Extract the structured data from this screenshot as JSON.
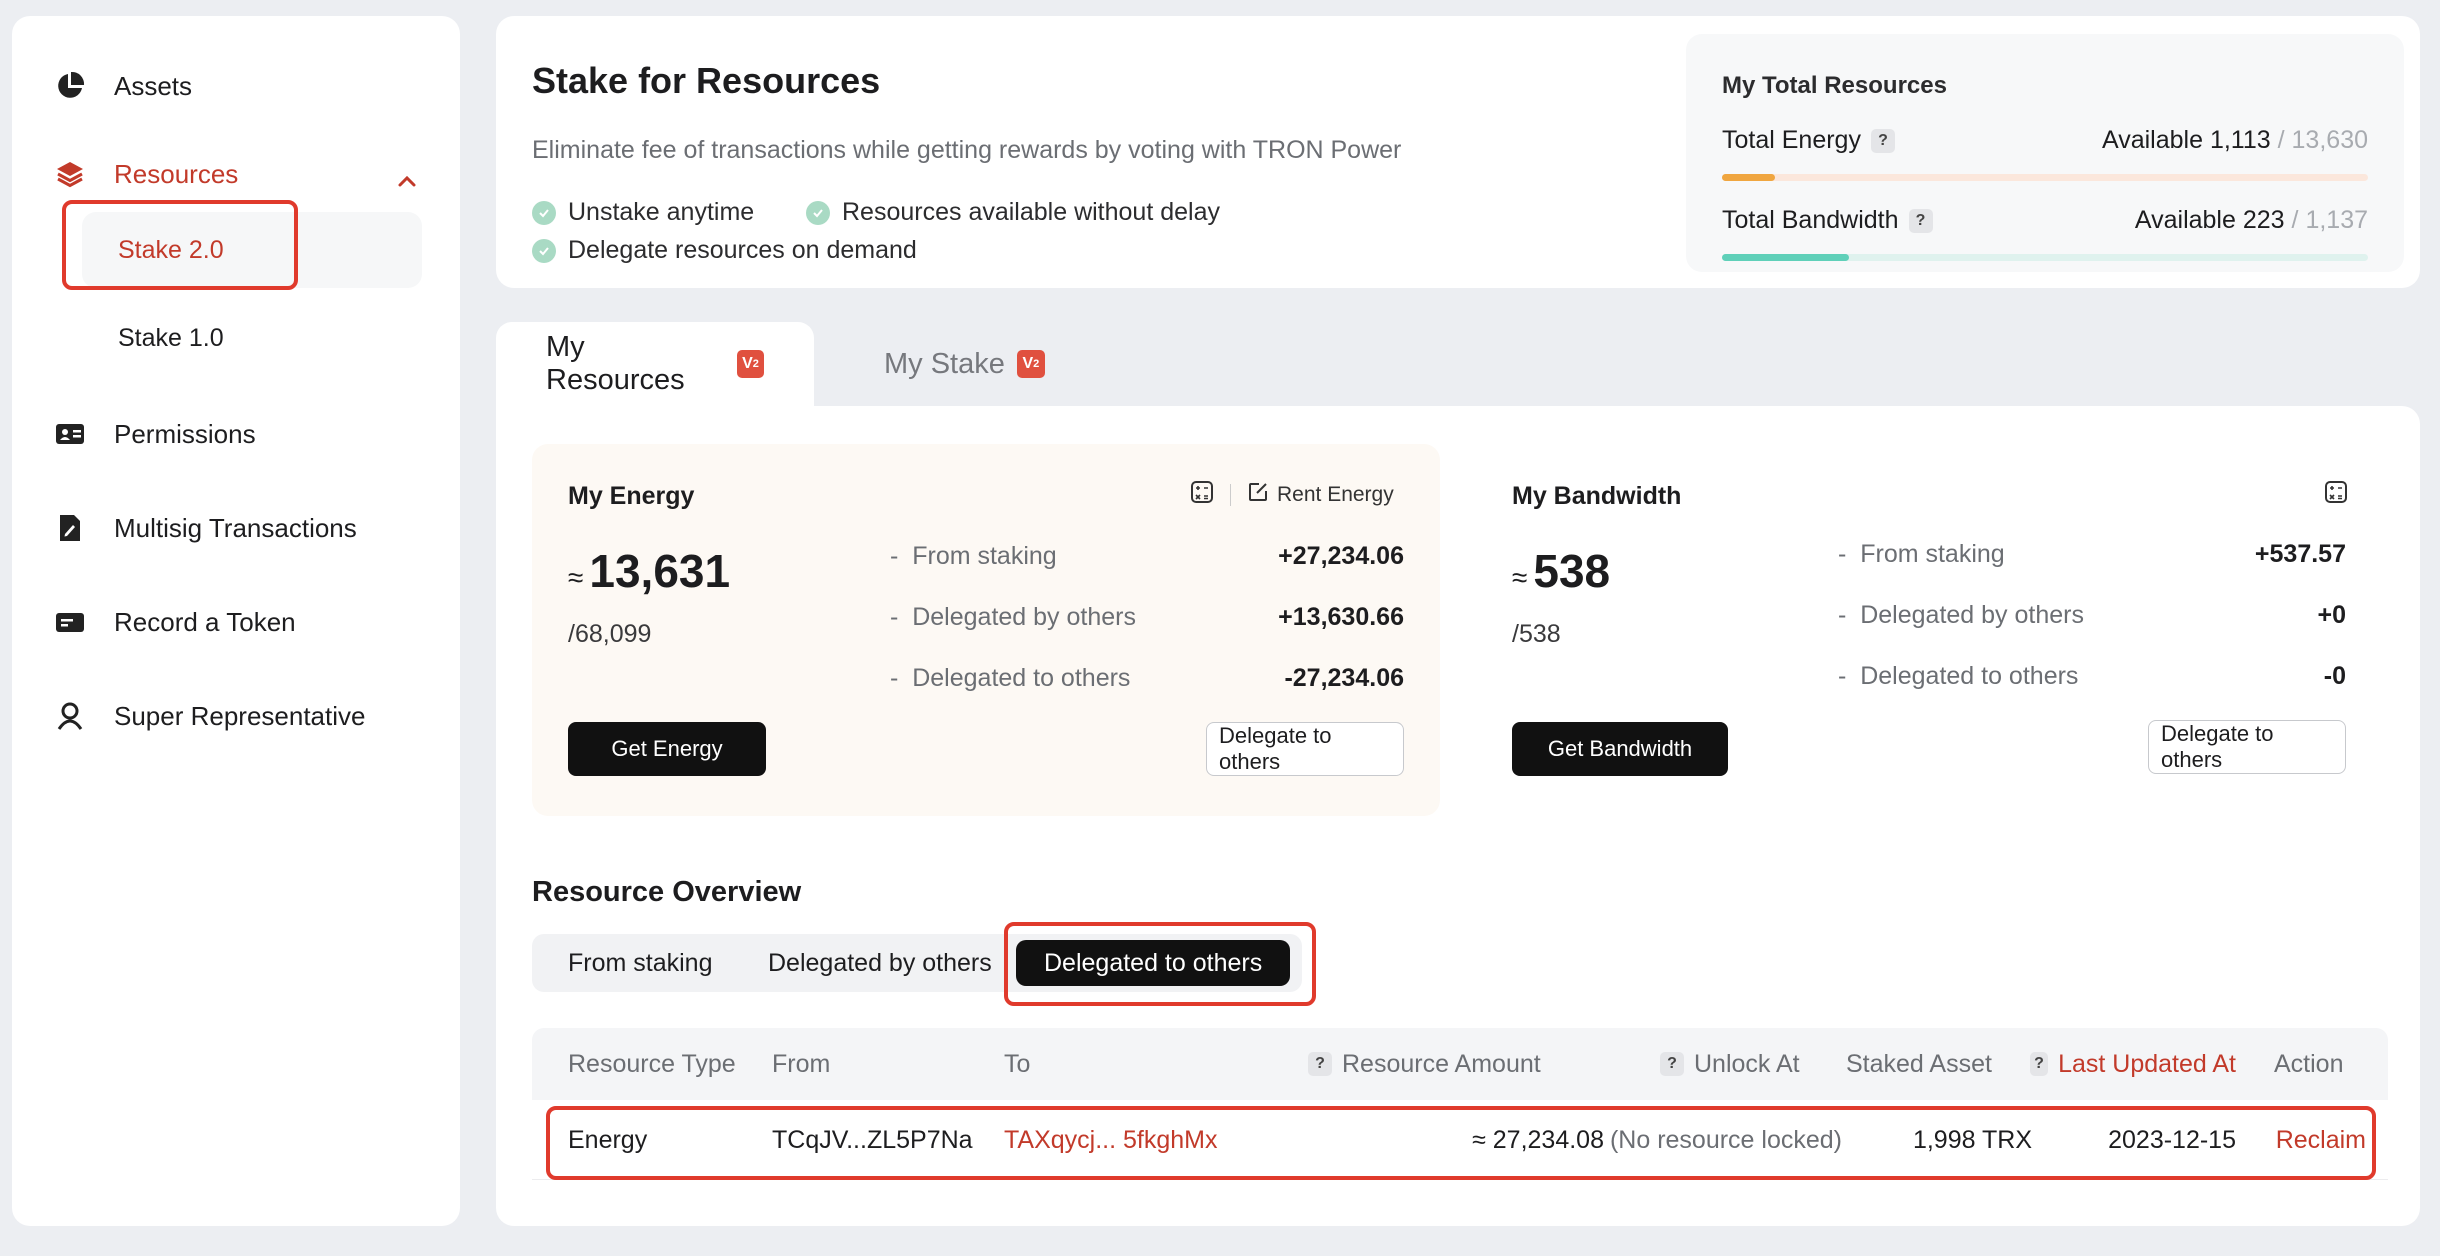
{
  "sidebar": {
    "items": [
      {
        "label": "Assets",
        "icon": "pie-chart-icon"
      },
      {
        "label": "Resources",
        "icon": "layers-icon"
      },
      {
        "label": "Permissions",
        "icon": "id-card-icon"
      },
      {
        "label": "Multisig Transactions",
        "icon": "document-edit-icon"
      },
      {
        "label": "Record a Token",
        "icon": "token-card-icon"
      },
      {
        "label": "Super Representative",
        "icon": "person-icon"
      }
    ],
    "sub_items": [
      {
        "label": "Stake 2.0"
      },
      {
        "label": "Stake 1.0"
      }
    ]
  },
  "header": {
    "title": "Stake for Resources",
    "subtitle": "Eliminate fee of transactions while getting rewards by voting with TRON Power",
    "features": [
      "Unstake anytime",
      "Resources available without delay",
      "Delegate resources on demand"
    ]
  },
  "total_resources": {
    "title": "My Total Resources",
    "energy": {
      "label": "Total Energy",
      "available_label": "Available",
      "available": "1,113",
      "sep": "/",
      "total": "13,630",
      "fraction": 0.082
    },
    "bandwidth": {
      "label": "Total Bandwidth",
      "available_label": "Available",
      "available": "223",
      "sep": "/",
      "total": "1,137",
      "fraction": 0.196
    },
    "help": "?"
  },
  "tabs": [
    {
      "label": "My Resources",
      "badge": "V2"
    },
    {
      "label": "My Stake",
      "badge": "V2"
    }
  ],
  "energy_card": {
    "title": "My Energy",
    "approx": "≈",
    "value": "13,631",
    "max": "/68,099",
    "rent_label": "Rent Energy",
    "lines": [
      {
        "label": "From staking",
        "value": "+27,234.06"
      },
      {
        "label": "Delegated by others",
        "value": "+13,630.66"
      },
      {
        "label": "Delegated to others",
        "value": "-27,234.06"
      }
    ],
    "primary_button": "Get Energy",
    "secondary_button": "Delegate to others"
  },
  "bandwidth_card": {
    "title": "My Bandwidth",
    "approx": "≈",
    "value": "538",
    "max": "/538",
    "lines": [
      {
        "label": "From staking",
        "value": "+537.57"
      },
      {
        "label": "Delegated by others",
        "value": "+0"
      },
      {
        "label": "Delegated to others",
        "value": "-0"
      }
    ],
    "primary_button": "Get Bandwidth",
    "secondary_button": "Delegate to others"
  },
  "overview": {
    "title": "Resource Overview",
    "segments": [
      "From staking",
      "Delegated by others",
      "Delegated to others"
    ],
    "active_segment": "Delegated to others",
    "columns": [
      "Resource Type",
      "From",
      "To",
      "Resource Amount",
      "Unlock At",
      "Staked Asset",
      "Last Updated At",
      "Action"
    ],
    "rows": [
      {
        "resource_type": "Energy",
        "from": "TCqJV...ZL5P7Na",
        "to": "TAXqycj... 5fkghMx",
        "amount": "≈ 27,234.08",
        "unlock_at": "(No resource locked)",
        "staked_asset": "1,998 TRX",
        "last_updated": "2023-12-15",
        "action": "Reclaim"
      }
    ]
  },
  "colors": {
    "accent": "#c23a2a",
    "highlight": "#e03a2c",
    "energy_bar": "#f0a640",
    "bandwidth_bar": "#5fd0b9",
    "dark_button": "#111111"
  }
}
